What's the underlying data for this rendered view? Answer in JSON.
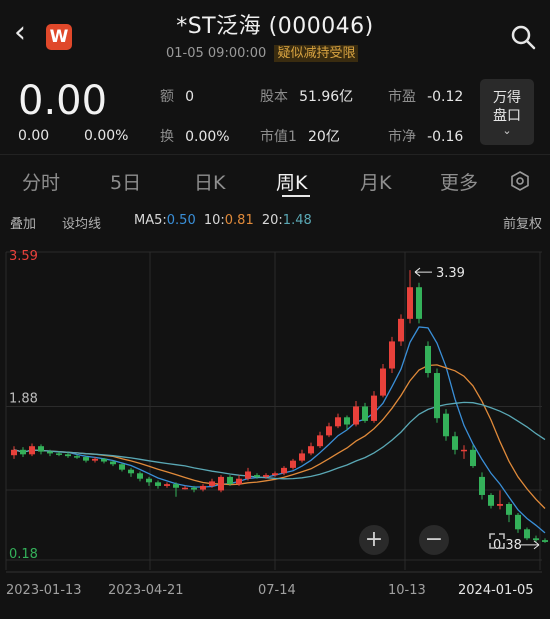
{
  "header": {
    "title": "*ST泛海 (000046)",
    "datetime": "01-05 09:00:00",
    "status_badge": "疑似减持受限",
    "app_logo": "W"
  },
  "quote": {
    "price": "0.00",
    "change": "0.00",
    "change_pct": "0.00%",
    "fields": [
      {
        "label": "额",
        "value": "0"
      },
      {
        "label": "换",
        "value": "0.00%"
      },
      {
        "label": "股本",
        "value": "51.96亿"
      },
      {
        "label": "市值1",
        "value": "20亿"
      },
      {
        "label": "市盈",
        "value": "-0.12"
      },
      {
        "label": "市净",
        "value": "-0.16"
      }
    ],
    "pankou_line1": "万得",
    "pankou_line2": "盘口"
  },
  "tabs": [
    "分时",
    "5日",
    "日K",
    "周K",
    "月K",
    "更多"
  ],
  "active_tab": "周K",
  "toolbar": {
    "overlay": "叠加",
    "set_ma": "设均线",
    "ma5_label": "MA5:",
    "ma5": "0.50",
    "ma10_label": "10:",
    "ma10": "0.81",
    "ma20_label": "20:",
    "ma20": "1.48",
    "adjust": "前复权"
  },
  "colors": {
    "up": "#e8413b",
    "down": "#34b15a",
    "ma5": "#3a8fd8",
    "ma10": "#e08a3a",
    "ma20": "#5aa8b5",
    "grid": "#2b2b2b"
  },
  "chart_data": {
    "type": "candlestick",
    "ylim": [
      0.18,
      3.59
    ],
    "y_ticks": [
      "3.59",
      "1.88",
      "0.18"
    ],
    "x_ticks": [
      "2023-01-13",
      "2023-04-21",
      "07-14",
      "10-13",
      "2024-01-05"
    ],
    "annotations": {
      "high": "3.39",
      "low": "0.38"
    },
    "candles": [
      {
        "o": 1.34,
        "c": 1.4,
        "h": 1.44,
        "l": 1.3
      },
      {
        "o": 1.4,
        "c": 1.35,
        "h": 1.43,
        "l": 1.32
      },
      {
        "o": 1.35,
        "c": 1.44,
        "h": 1.47,
        "l": 1.33
      },
      {
        "o": 1.44,
        "c": 1.38,
        "h": 1.46,
        "l": 1.35
      },
      {
        "o": 1.38,
        "c": 1.36,
        "h": 1.4,
        "l": 1.33
      },
      {
        "o": 1.36,
        "c": 1.35,
        "h": 1.38,
        "l": 1.33
      },
      {
        "o": 1.35,
        "c": 1.33,
        "h": 1.37,
        "l": 1.31
      },
      {
        "o": 1.33,
        "c": 1.32,
        "h": 1.35,
        "l": 1.3
      },
      {
        "o": 1.32,
        "c": 1.28,
        "h": 1.33,
        "l": 1.26
      },
      {
        "o": 1.28,
        "c": 1.3,
        "h": 1.32,
        "l": 1.26
      },
      {
        "o": 1.3,
        "c": 1.27,
        "h": 1.31,
        "l": 1.25
      },
      {
        "o": 1.27,
        "c": 1.24,
        "h": 1.28,
        "l": 1.22
      },
      {
        "o": 1.24,
        "c": 1.18,
        "h": 1.25,
        "l": 1.16
      },
      {
        "o": 1.18,
        "c": 1.14,
        "h": 1.2,
        "l": 1.1
      },
      {
        "o": 1.14,
        "c": 1.08,
        "h": 1.16,
        "l": 1.05
      },
      {
        "o": 1.08,
        "c": 1.04,
        "h": 1.1,
        "l": 1.0
      },
      {
        "o": 1.04,
        "c": 1.0,
        "h": 1.06,
        "l": 0.97
      },
      {
        "o": 1.0,
        "c": 1.02,
        "h": 1.04,
        "l": 0.98
      },
      {
        "o": 1.02,
        "c": 0.98,
        "h": 1.04,
        "l": 0.88
      },
      {
        "o": 0.98,
        "c": 0.98,
        "h": 1.0,
        "l": 0.96
      },
      {
        "o": 0.98,
        "c": 0.96,
        "h": 1.0,
        "l": 0.93
      },
      {
        "o": 0.96,
        "c": 1.0,
        "h": 1.02,
        "l": 0.94
      },
      {
        "o": 1.0,
        "c": 1.05,
        "h": 1.08,
        "l": 0.98
      },
      {
        "o": 0.95,
        "c": 1.1,
        "h": 1.12,
        "l": 0.93
      },
      {
        "o": 1.1,
        "c": 1.02,
        "h": 1.12,
        "l": 1.0
      },
      {
        "o": 1.02,
        "c": 1.08,
        "h": 1.12,
        "l": 1.0
      },
      {
        "o": 1.08,
        "c": 1.16,
        "h": 1.2,
        "l": 1.06
      },
      {
        "o": 1.12,
        "c": 1.1,
        "h": 1.14,
        "l": 1.08
      },
      {
        "o": 1.1,
        "c": 1.12,
        "h": 1.14,
        "l": 1.08
      },
      {
        "o": 1.12,
        "c": 1.14,
        "h": 1.16,
        "l": 1.1
      },
      {
        "o": 1.14,
        "c": 1.2,
        "h": 1.22,
        "l": 1.12
      },
      {
        "o": 1.2,
        "c": 1.28,
        "h": 1.3,
        "l": 1.18
      },
      {
        "o": 1.28,
        "c": 1.36,
        "h": 1.4,
        "l": 1.26
      },
      {
        "o": 1.36,
        "c": 1.44,
        "h": 1.48,
        "l": 1.34
      },
      {
        "o": 1.44,
        "c": 1.56,
        "h": 1.6,
        "l": 1.42
      },
      {
        "o": 1.56,
        "c": 1.66,
        "h": 1.7,
        "l": 1.54
      },
      {
        "o": 1.66,
        "c": 1.76,
        "h": 1.8,
        "l": 1.64
      },
      {
        "o": 1.76,
        "c": 1.68,
        "h": 1.78,
        "l": 1.62
      },
      {
        "o": 1.68,
        "c": 1.88,
        "h": 1.94,
        "l": 1.66
      },
      {
        "o": 1.88,
        "c": 1.72,
        "h": 1.92,
        "l": 1.7
      },
      {
        "o": 1.72,
        "c": 2.0,
        "h": 2.05,
        "l": 1.7
      },
      {
        "o": 2.0,
        "c": 2.3,
        "h": 2.35,
        "l": 1.98
      },
      {
        "o": 2.3,
        "c": 2.6,
        "h": 2.65,
        "l": 2.25
      },
      {
        "o": 2.6,
        "c": 2.85,
        "h": 2.9,
        "l": 2.55
      },
      {
        "o": 2.85,
        "c": 3.2,
        "h": 3.39,
        "l": 2.8
      },
      {
        "o": 3.2,
        "c": 2.85,
        "h": 3.25,
        "l": 2.8
      },
      {
        "o": 2.55,
        "c": 2.25,
        "h": 2.6,
        "l": 2.2
      },
      {
        "o": 2.25,
        "c": 1.75,
        "h": 2.3,
        "l": 1.7
      },
      {
        "o": 1.8,
        "c": 1.55,
        "h": 1.85,
        "l": 1.5
      },
      {
        "o": 1.55,
        "c": 1.4,
        "h": 1.6,
        "l": 1.35
      },
      {
        "o": 1.4,
        "c": 1.4,
        "h": 1.45,
        "l": 1.3
      },
      {
        "o": 1.4,
        "c": 1.22,
        "h": 1.45,
        "l": 1.2
      },
      {
        "o": 1.1,
        "c": 0.9,
        "h": 1.15,
        "l": 0.85
      },
      {
        "o": 0.9,
        "c": 0.78,
        "h": 0.92,
        "l": 0.75
      },
      {
        "o": 0.78,
        "c": 0.8,
        "h": 0.95,
        "l": 0.74
      },
      {
        "o": 0.8,
        "c": 0.68,
        "h": 0.82,
        "l": 0.6
      },
      {
        "o": 0.68,
        "c": 0.52,
        "h": 0.7,
        "l": 0.48
      },
      {
        "o": 0.52,
        "c": 0.42,
        "h": 0.54,
        "l": 0.4
      },
      {
        "o": 0.42,
        "c": 0.4,
        "h": 0.45,
        "l": 0.38
      },
      {
        "o": 0.4,
        "c": 0.38,
        "h": 0.42,
        "l": 0.37
      }
    ]
  }
}
